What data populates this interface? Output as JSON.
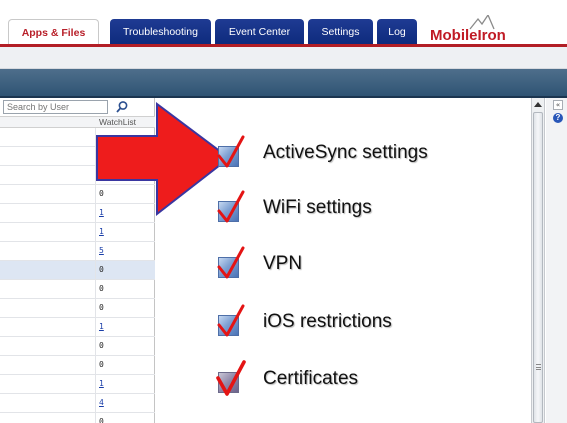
{
  "nav": {
    "tabs": [
      {
        "label": "Apps & Files",
        "active": true
      },
      {
        "label": "Troubleshooting",
        "active": false
      },
      {
        "label": "Event Center",
        "active": false
      },
      {
        "label": "Settings",
        "active": false
      },
      {
        "label": "Log",
        "active": false
      }
    ],
    "brand": "MobileIron"
  },
  "left_panel": {
    "search_placeholder": "Search by User",
    "column_header": "WatchList",
    "rows": [
      {
        "value": "",
        "link": false,
        "selected": false
      },
      {
        "value": "",
        "link": false,
        "selected": false
      },
      {
        "value": "",
        "link": false,
        "selected": false
      },
      {
        "value": "0",
        "link": false,
        "selected": false
      },
      {
        "value": "1",
        "link": true,
        "selected": false
      },
      {
        "value": "1",
        "link": true,
        "selected": false
      },
      {
        "value": "5",
        "link": true,
        "selected": false
      },
      {
        "value": "0",
        "link": false,
        "selected": true
      },
      {
        "value": "0",
        "link": false,
        "selected": false
      },
      {
        "value": "0",
        "link": false,
        "selected": false
      },
      {
        "value": "1",
        "link": true,
        "selected": false
      },
      {
        "value": "0",
        "link": false,
        "selected": false
      },
      {
        "value": "0",
        "link": false,
        "selected": false
      },
      {
        "value": "1",
        "link": true,
        "selected": false
      },
      {
        "value": "4",
        "link": true,
        "selected": false
      },
      {
        "value": "0",
        "link": false,
        "selected": false
      }
    ]
  },
  "checklist": [
    {
      "label": "ActiveSync settings",
      "checked": true
    },
    {
      "label": "WiFi settings",
      "checked": true
    },
    {
      "label": "VPN",
      "checked": true
    },
    {
      "label": "iOS restrictions",
      "checked": true
    },
    {
      "label": "Certificates",
      "checked": true
    }
  ],
  "right_strip": {
    "collapse_label": "«",
    "help_label": "?"
  },
  "colors": {
    "brand_red": "#c01a24",
    "nav_blue": "#0d2a7c",
    "arrow_red": "#ee1c1c",
    "arrow_outline": "#3a36a0"
  }
}
